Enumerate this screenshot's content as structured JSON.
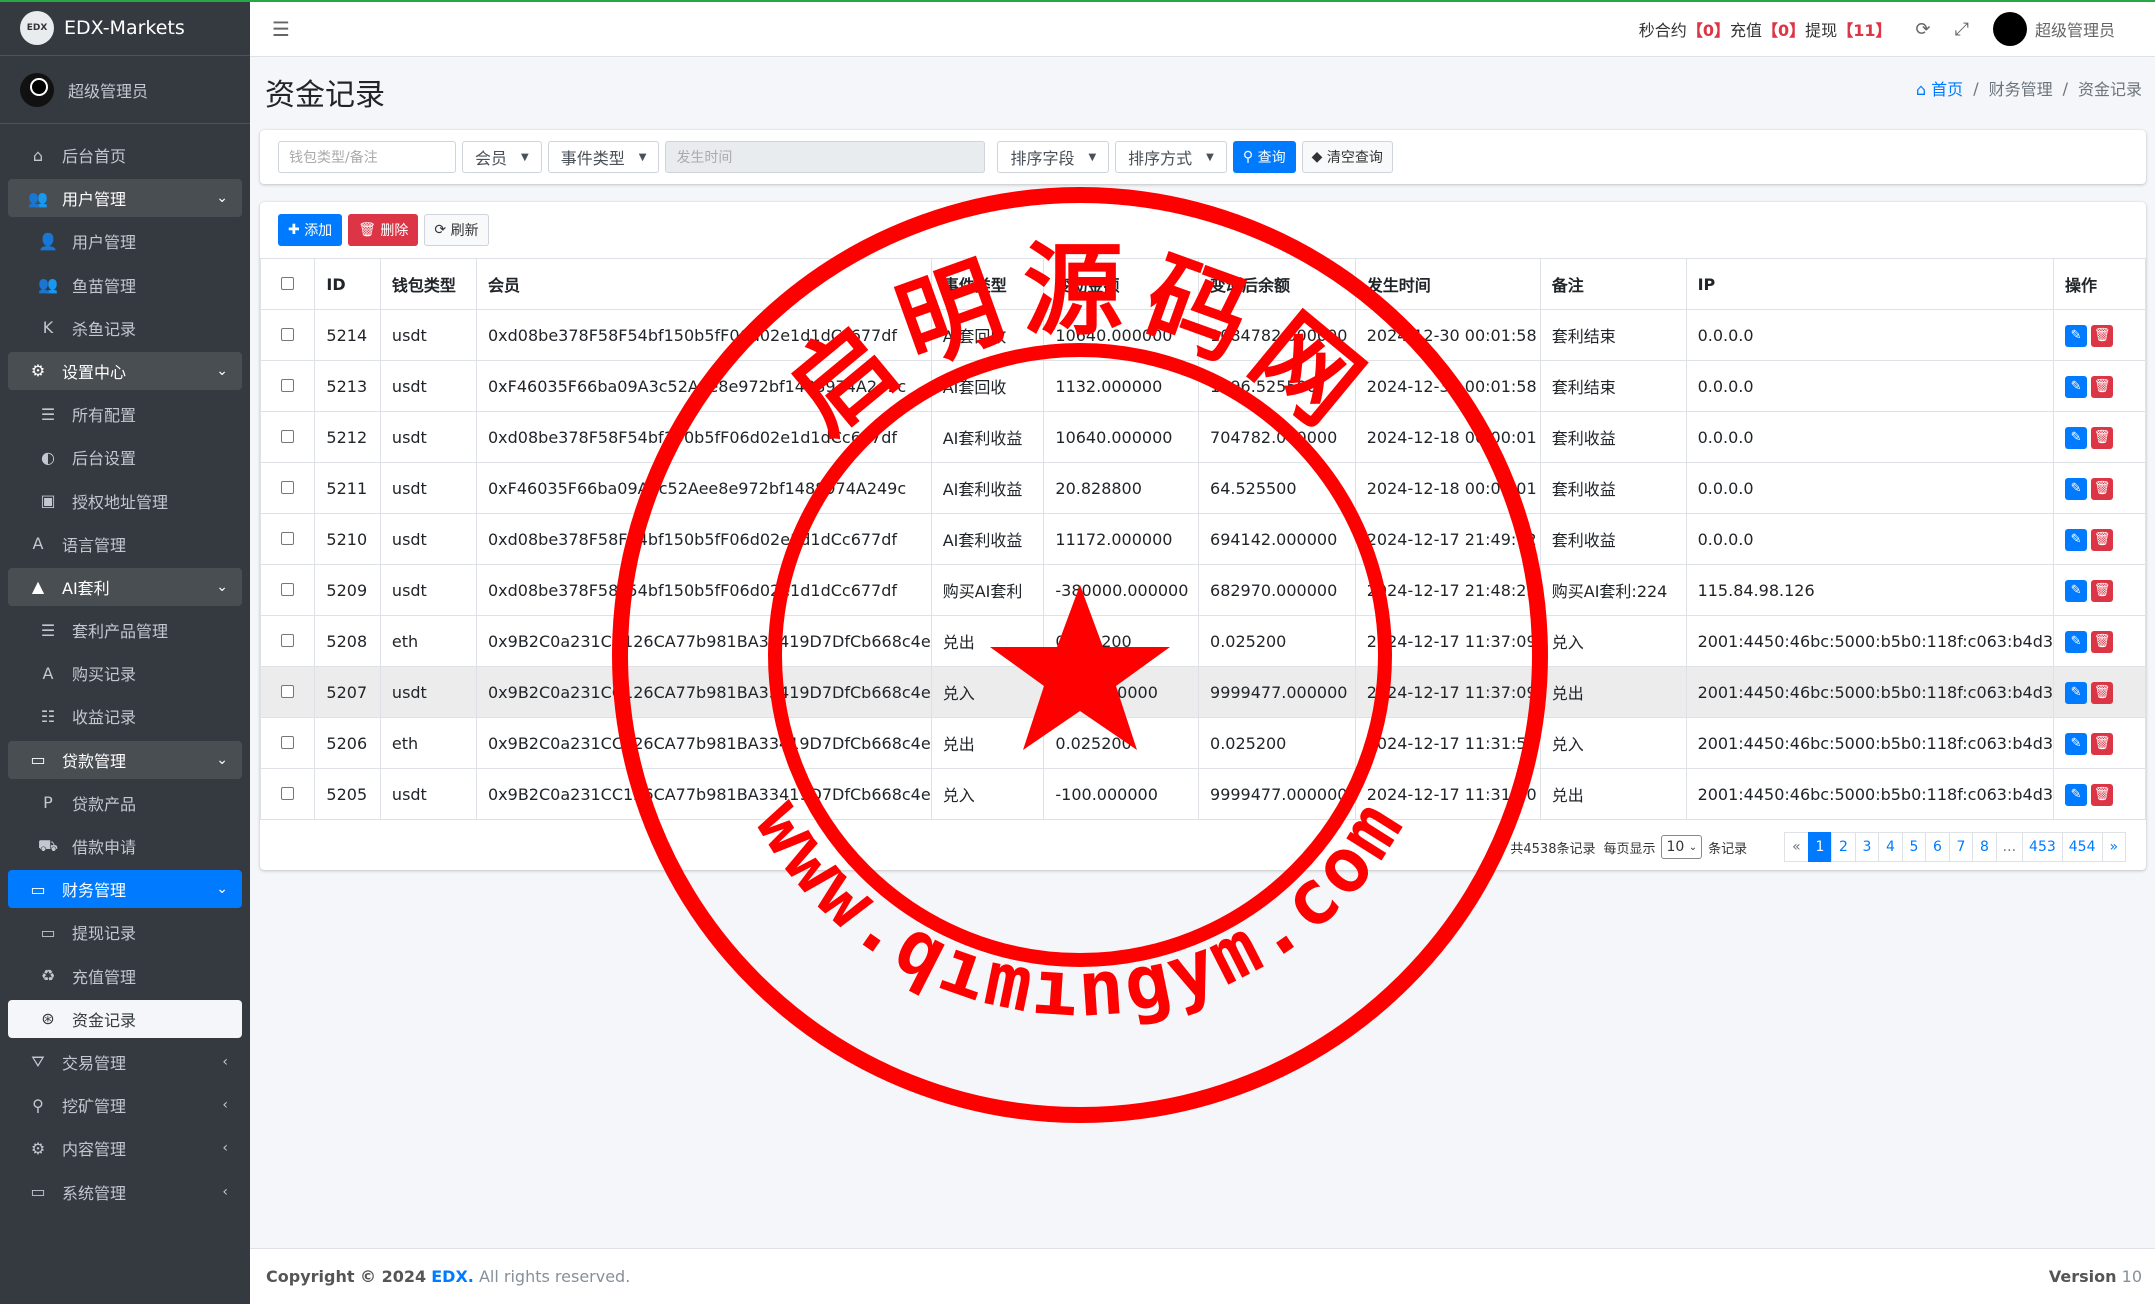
{
  "app": {
    "brand": "EDX-Markets",
    "brand_logo": "EDX",
    "user": "超级管理员"
  },
  "sidebar": {
    "items": [
      {
        "label": "后台首页",
        "icon": "home-icon",
        "glyph": "⌂",
        "type": "top"
      },
      {
        "label": "用户管理",
        "icon": "users-icon",
        "glyph": "👥",
        "type": "header"
      },
      {
        "label": "用户管理",
        "icon": "user-icon",
        "glyph": "👤",
        "type": "sub"
      },
      {
        "label": "鱼苗管理",
        "icon": "users-icon",
        "glyph": "👥",
        "type": "sub"
      },
      {
        "label": "杀鱼记录",
        "icon": "k-icon",
        "glyph": "K",
        "type": "sub"
      },
      {
        "label": "设置中心",
        "icon": "gears-icon",
        "glyph": "⚙",
        "type": "header"
      },
      {
        "label": "所有配置",
        "icon": "list-icon",
        "glyph": "☰",
        "type": "sub"
      },
      {
        "label": "后台设置",
        "icon": "half-circle-icon",
        "glyph": "◐",
        "type": "sub"
      },
      {
        "label": "授权地址管理",
        "icon": "id-card-icon",
        "glyph": "▣",
        "type": "sub"
      },
      {
        "label": "语言管理",
        "icon": "language-icon",
        "glyph": "A",
        "type": "top"
      },
      {
        "label": "AI套利",
        "icon": "mountain-icon",
        "glyph": "▲",
        "type": "header"
      },
      {
        "label": "套利产品管理",
        "icon": "bars-icon",
        "glyph": "☰",
        "type": "sub"
      },
      {
        "label": "购买记录",
        "icon": "a-square-icon",
        "glyph": "A",
        "type": "sub"
      },
      {
        "label": "收益记录",
        "icon": "list-check-icon",
        "glyph": "☷",
        "type": "sub"
      },
      {
        "label": "贷款管理",
        "icon": "money-icon",
        "glyph": "▭",
        "type": "header"
      },
      {
        "label": "贷款产品",
        "icon": "product-icon",
        "glyph": "P",
        "type": "sub"
      },
      {
        "label": "借款申请",
        "icon": "truck-icon",
        "glyph": "⛟",
        "type": "sub"
      },
      {
        "label": "财务管理",
        "icon": "money-icon",
        "glyph": "▭",
        "type": "active"
      },
      {
        "label": "提现记录",
        "icon": "money-icon",
        "glyph": "▭",
        "type": "sub"
      },
      {
        "label": "充值管理",
        "icon": "recycle-icon",
        "glyph": "♻",
        "type": "sub"
      },
      {
        "label": "资金记录",
        "icon": "basketball-icon",
        "glyph": "⊛",
        "type": "selected"
      },
      {
        "label": "交易管理",
        "icon": "network-icon",
        "glyph": "⛛",
        "type": "collapsed"
      },
      {
        "label": "挖矿管理",
        "icon": "search-icon",
        "glyph": "⚲",
        "type": "collapsed"
      },
      {
        "label": "内容管理",
        "icon": "gear-icon",
        "glyph": "⚙",
        "type": "collapsed"
      },
      {
        "label": "系统管理",
        "icon": "desktop-icon",
        "glyph": "▭",
        "type": "collapsed"
      }
    ]
  },
  "topbar": {
    "seconds_label": "秒合约",
    "seconds_count": "0",
    "recharge_label": "充值",
    "recharge_count": "0",
    "withdraw_label": "提现",
    "withdraw_count": "11",
    "user": "超级管理员"
  },
  "page": {
    "title": "资金记录",
    "breadcrumb": [
      "首页",
      "财务管理",
      "资金记录"
    ]
  },
  "filters": {
    "wallet_placeholder": "钱包类型/备注",
    "member": "会员",
    "event_type": "事件类型",
    "time_placeholder": "发生时间",
    "sort_field": "排序字段",
    "sort_order": "排序方式",
    "search_btn": "查询",
    "clear_btn": "清空查询"
  },
  "toolbar": {
    "add": "添加",
    "delete": "删除",
    "refresh": "刷新"
  },
  "table": {
    "columns": [
      "ID",
      "钱包类型",
      "会员",
      "事件类型",
      "变动金额",
      "变动后余额",
      "发生时间",
      "备注",
      "IP",
      "操作"
    ],
    "rows": [
      {
        "id": "5214",
        "wallet": "usdt",
        "member": "0xd08be378F58F54bf150b5fF06d02e1d1dCc677df",
        "event": "AI套回收",
        "amount": "10640.000000",
        "balance": "1084782.000000",
        "time": "2024-12-30 00:01:58",
        "note": "套利结束",
        "ip": "0.0.0.0"
      },
      {
        "id": "5213",
        "wallet": "usdt",
        "member": "0xF46035F66ba09A3c52Aee8e972bf1488974A249c",
        "event": "AI套回收",
        "amount": "1132.000000",
        "balance": "1196.525500",
        "time": "2024-12-30 00:01:58",
        "note": "套利结束",
        "ip": "0.0.0.0"
      },
      {
        "id": "5212",
        "wallet": "usdt",
        "member": "0xd08be378F58F54bf150b5fF06d02e1d1dCc677df",
        "event": "AI套利收益",
        "amount": "10640.000000",
        "balance": "704782.000000",
        "time": "2024-12-18 00:00:01",
        "note": "套利收益",
        "ip": "0.0.0.0"
      },
      {
        "id": "5211",
        "wallet": "usdt",
        "member": "0xF46035F66ba09A3c52Aee8e972bf1488974A249c",
        "event": "AI套利收益",
        "amount": "20.828800",
        "balance": "64.525500",
        "time": "2024-12-18 00:00:01",
        "note": "套利收益",
        "ip": "0.0.0.0"
      },
      {
        "id": "5210",
        "wallet": "usdt",
        "member": "0xd08be378F58F54bf150b5fF06d02e1d1dCc677df",
        "event": "AI套利收益",
        "amount": "11172.000000",
        "balance": "694142.000000",
        "time": "2024-12-17 21:49:02",
        "note": "套利收益",
        "ip": "0.0.0.0"
      },
      {
        "id": "5209",
        "wallet": "usdt",
        "member": "0xd08be378F58F54bf150b5fF06d02e1d1dCc677df",
        "event": "购买AI套利",
        "amount": "-380000.000000",
        "balance": "682970.000000",
        "time": "2024-12-17 21:48:23",
        "note": "购买AI套利:224",
        "ip": "115.84.98.126"
      },
      {
        "id": "5208",
        "wallet": "eth",
        "member": "0x9B2C0a231CC126CA77b981BA33419D7DfCb668c4e",
        "event": "兑出",
        "amount": "0.025200",
        "balance": "0.025200",
        "time": "2024-12-17 11:37:09",
        "note": "兑入",
        "ip": "2001:4450:46bc:5000:b5b0:118f:c063:b4d3"
      },
      {
        "id": "5207",
        "wallet": "usdt",
        "member": "0x9B2C0a231CC126CA77b981BA33419D7DfCb668c4e",
        "event": "兑入",
        "amount": "-100.000000",
        "balance": "9999477.000000",
        "time": "2024-12-17 11:37:09",
        "note": "兑出",
        "ip": "2001:4450:46bc:5000:b5b0:118f:c063:b4d3"
      },
      {
        "id": "5206",
        "wallet": "eth",
        "member": "0x9B2C0a231CC126CA77b981BA33419D7DfCb668c4e",
        "event": "兑出",
        "amount": "0.025200",
        "balance": "0.025200",
        "time": "2024-12-17 11:31:50",
        "note": "兑入",
        "ip": "2001:4450:46bc:5000:b5b0:118f:c063:b4d3"
      },
      {
        "id": "5205",
        "wallet": "usdt",
        "member": "0x9B2C0a231CC126CA77b981BA33419D7DfCb668c4e",
        "event": "兑入",
        "amount": "-100.000000",
        "balance": "9999477.000000",
        "time": "2024-12-17 11:31:50",
        "note": "兑出",
        "ip": "2001:4450:46bc:5000:b5b0:118f:c063:b4d3"
      }
    ]
  },
  "pager": {
    "total": "共4538条记录",
    "per_page_label": "每页显示",
    "per_page": "10",
    "per_page_suffix": "条记录",
    "pages": [
      "«",
      "1",
      "2",
      "3",
      "4",
      "5",
      "6",
      "7",
      "8",
      "...",
      "453",
      "454",
      "»"
    ],
    "current": "1"
  },
  "footer": {
    "copyright_prefix": "Copyright © 2024",
    "brand": "EDX.",
    "rights": "All rights reserved.",
    "version_label": "Version",
    "version": "10"
  },
  "stamp": {
    "top_text": "启明源码网",
    "bottom_text": "www.qimingym.com",
    "color": "#ff0000"
  }
}
